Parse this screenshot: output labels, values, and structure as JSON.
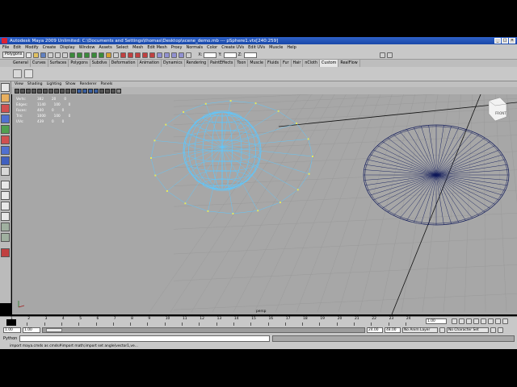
{
  "window": {
    "title": "Autodesk Maya 2009 Unlimited: C:\\Documents and Settings\\thomas\\Desktop\\scene_demo.mb --- pSphere1.vtx[240:259]",
    "buttons": [
      "_",
      "□",
      "×"
    ]
  },
  "menubar": {
    "items": [
      "File",
      "Edit",
      "Modify",
      "Create",
      "Display",
      "Window",
      "Assets",
      "Select",
      "Mesh",
      "Edit Mesh",
      "Proxy",
      "Normals",
      "Color",
      "Create UVs",
      "Edit UVs",
      "Muscle",
      "Help"
    ]
  },
  "statusline": {
    "mode": "Polygons",
    "x_label": "X:",
    "y_label": "Y:",
    "z_label": "Z:"
  },
  "shelf": {
    "tabs": [
      "General",
      "Curves",
      "Surfaces",
      "Polygons",
      "Subdivs",
      "Deformation",
      "Animation",
      "Dynamics",
      "Rendering",
      "PaintEffects",
      "Toon",
      "Muscle",
      "Fluids",
      "Fur",
      "Hair",
      "nCloth",
      "Custom",
      "RealFlow"
    ],
    "active_tab": "Custom"
  },
  "panel": {
    "menus": [
      "View",
      "Shading",
      "Lighting",
      "Show",
      "Renderer",
      "Panels"
    ],
    "camera": "persp",
    "viewcube": "FRONT"
  },
  "hud": {
    "rows": [
      {
        "label": "Verts:",
        "v1": "382",
        "v2": "20",
        "v3": "0"
      },
      {
        "label": "Edges:",
        "v1": "1140",
        "v2": "100",
        "v3": "0"
      },
      {
        "label": "Faces:",
        "v1": "400",
        "v2": "0",
        "v3": "0"
      },
      {
        "label": "Tris:",
        "v1": "1000",
        "v2": "100",
        "v3": "0"
      },
      {
        "label": "UVs:",
        "v1": "439",
        "v2": "0",
        "v3": "0"
      }
    ]
  },
  "timeline": {
    "ticks": [
      "1",
      "2",
      "3",
      "4",
      "5",
      "6",
      "7",
      "8",
      "9",
      "10",
      "11",
      "12",
      "13",
      "14",
      "15",
      "16",
      "17",
      "18",
      "19",
      "20",
      "21",
      "22",
      "23",
      "24"
    ],
    "current_frame": "1.00"
  },
  "range": {
    "start": "1.00",
    "inner_start": "1.00",
    "end": "24.00",
    "inner_end": "48.00",
    "anim_layer": "No Anim Layer",
    "character_set": "No Character Set"
  },
  "cmdline": {
    "label": "Python"
  },
  "helpline": {
    "text": "import maya.cmds as cmds#import math;import set angle(vector1,ve..."
  },
  "colors": {
    "viewport": "#a7a7a7",
    "wire_selected": "#5ec8ff",
    "wire_default": "#101a5a",
    "vertex_highlight": "#e8e85a"
  }
}
